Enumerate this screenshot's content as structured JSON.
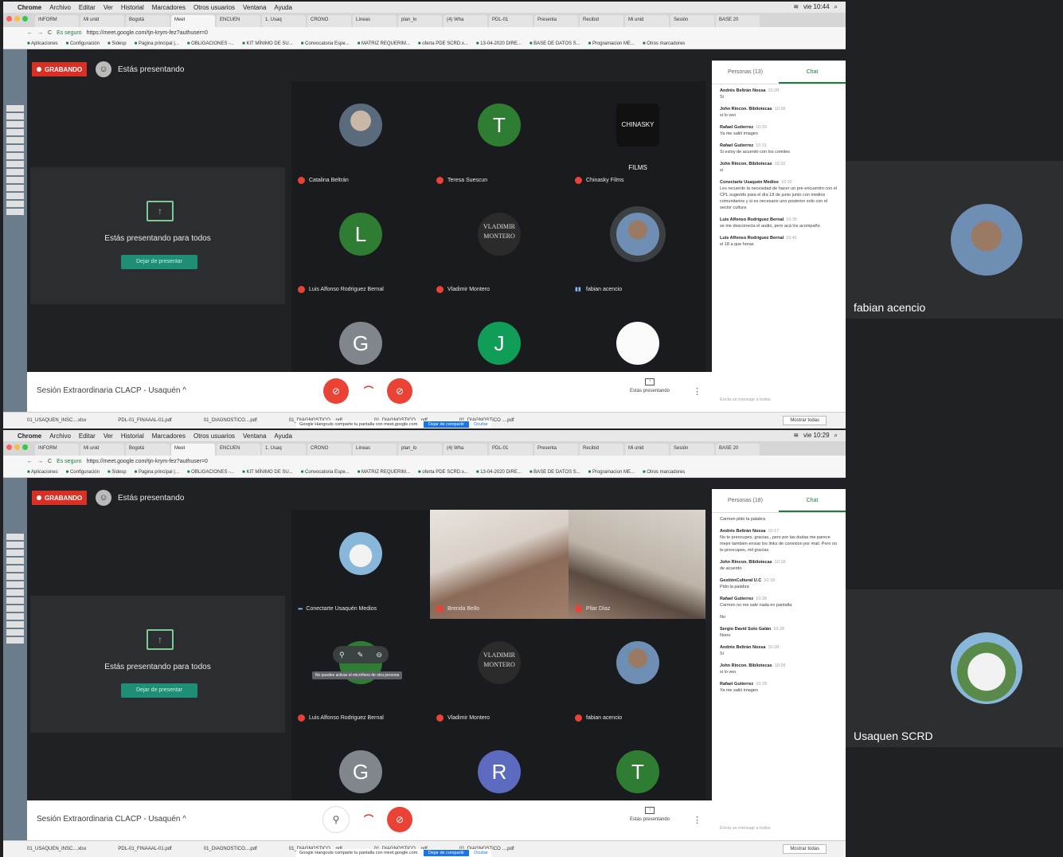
{
  "menubar": {
    "app": "Chrome",
    "items": [
      "Archivo",
      "Editar",
      "Ver",
      "Historial",
      "Marcadores",
      "Otros usuarios",
      "Ventana",
      "Ayuda"
    ]
  },
  "tabs": [
    "INFORM",
    "Mi unid",
    "Bogotá",
    "Meet",
    "ENCUEN",
    "1. Usaq",
    "CRONO",
    "Líneas",
    "plan_lo",
    "(4) Wha",
    "PDL-01",
    "Presenta",
    "Recibid",
    "Mi unid",
    "Sesión",
    "BASE 20"
  ],
  "address": {
    "secure_label": "Es seguro",
    "url": "https://meet.google.com/tjn-krym-fez?authuser=0"
  },
  "bookmarks": [
    "Aplicaciones",
    "Configuración",
    "Sidesp",
    "Pagina principal |...",
    "OBLIGACIONES -...",
    "KIT MÍNIMO DE SU...",
    "Convocatoria Espe...",
    "MATRIZ REQUERIM...",
    "oferta PDE SCRD.x...",
    "13-04-2020 DIRE...",
    "BASE DE DATOS S...",
    "Programacion ME...",
    "Otros marcadores"
  ],
  "meet": {
    "recording_label": "GRABANDO",
    "presenting_label": "Estás presentando",
    "present_panel_text": "Estás presentando para todos",
    "stop_presenting": "Dejar de presentar",
    "meeting_title": "Sesión Extraordinaria CLACP - Usaquén",
    "present_now_label": "Estás presentando",
    "chat_tab": "Chat",
    "chat_placeholder": "Envía un mensaje a todos",
    "downloads": [
      "01_USAQUEN_INSC....xlsx",
      "PDL-01_FINAAAL-01.pdf",
      "01_DIAGNOSTICO....pdf",
      "01_DIAGNOSTICO....pdf",
      "01_DIAGNOSTICO....pdf",
      "01_DIAGNOSTICO ....pdf"
    ],
    "show_all": "Mostrar todas",
    "share_notice": "Google Hangouts comparte tu pantalla con meet.google.com.",
    "share_stop": "Dejar de compartir",
    "share_hide": "Ocultar"
  },
  "top": {
    "clock": "vie 10:44",
    "people_tab": "Personas (13)",
    "tiles": [
      {
        "name": "Catalina Beltrán",
        "letter": "",
        "style": "photo",
        "mic": "off"
      },
      {
        "name": "Teresa Suescun",
        "letter": "T",
        "style": "green",
        "mic": "off"
      },
      {
        "name": "Chinasky Films",
        "letter": "CHINASKY FILMS",
        "style": "logo",
        "mic": "off"
      },
      {
        "name": "Luis Alfonso Rodriguez Bernal",
        "letter": "L",
        "style": "green",
        "mic": "off"
      },
      {
        "name": "Vladimir Montero",
        "letter": "VLADIMIR MONTERO",
        "style": "vlad",
        "mic": "off"
      },
      {
        "name": "fabian acencio",
        "letter": "",
        "style": "photo2",
        "mic": "on"
      },
      {
        "name": "",
        "letter": "G",
        "style": "grey",
        "mic": ""
      },
      {
        "name": "",
        "letter": "J",
        "style": "teal",
        "mic": ""
      },
      {
        "name": "",
        "letter": "",
        "style": "market",
        "mic": ""
      }
    ],
    "chat": [
      {
        "sender": "Andrés Beltrán Nossa",
        "time": "10:28",
        "text": "Si"
      },
      {
        "sender": "John Rincon. Bibliotecas",
        "time": "10:28",
        "text": "si lo veo"
      },
      {
        "sender": "Rafael Gutierrez",
        "time": "10:29",
        "text": "Ya me salió imagen"
      },
      {
        "sender": "Rafael Gutierrez",
        "time": "10:31",
        "text": "Si estoy de acuerdo con los comites"
      },
      {
        "sender": "John Rincon. Bibliotecas",
        "time": "10:32",
        "text": "si"
      },
      {
        "sender": "Conectarte Usaquén Medios",
        "time": "10:32",
        "text": "Les recuerdo la necesidad de hacer un pre-encuentro con el CPL sugerido para el día 18 de junio junto con medios comunitarios y si es necesario uno posterior solo con el sector cultura"
      },
      {
        "sender": "Luis Alfonso Rodriguez Bernal",
        "time": "10:35",
        "text": "se me desconecta el audio, pero acá los acompaño"
      },
      {
        "sender": "Luis Alfonso Rodriguez Bernal",
        "time": "10:41",
        "text": "el 18 a que horas"
      }
    ],
    "side_name": "fabian acencio"
  },
  "bottom": {
    "clock": "vie 10:29",
    "people_tab": "Personas (18)",
    "tiles": [
      {
        "name": "Conectarte Usaquén Medios",
        "letter": "",
        "style": "church",
        "mic": "dots"
      },
      {
        "name": "Brenda Bello",
        "letter": "",
        "style": "video1",
        "mic": "off"
      },
      {
        "name": "Pilar Díaz",
        "letter": "",
        "style": "video2",
        "mic": "off"
      },
      {
        "name": "Luis Alfonso Rodriguez Bernal",
        "letter": "",
        "style": "green",
        "mic": "off"
      },
      {
        "name": "Vladimir Montero",
        "letter": "VLADIMIR MONTERO",
        "style": "vlad",
        "mic": "off"
      },
      {
        "name": "fabian acencio",
        "letter": "",
        "style": "photo2",
        "mic": "off"
      },
      {
        "name": "",
        "letter": "G",
        "style": "grey",
        "mic": ""
      },
      {
        "name": "",
        "letter": "R",
        "style": "blue",
        "mic": ""
      },
      {
        "name": "",
        "letter": "T",
        "style": "green",
        "mic": ""
      }
    ],
    "tooltip": "No puedes activar el micrófono de otra persona",
    "chat": [
      {
        "sender": "",
        "time": "",
        "text": "Carmen pido la palabra"
      },
      {
        "sender": "Andrés Beltrán Nossa",
        "time": "10:17",
        "text": "No te preocupes, gracias., pero por las dudas me parece mejor tambien enviar los links de conexion por mail. Pero no te preocupes, mil gracias."
      },
      {
        "sender": "John Rincon. Bibliotecas",
        "time": "10:18",
        "text": "de acuerdo"
      },
      {
        "sender": "GestiónCultural U.C",
        "time": "10:18",
        "text": "Pido la palabra"
      },
      {
        "sender": "Rafael Gutierrez",
        "time": "10:28",
        "text": "Carmen no me sale nada en pantalla"
      },
      {
        "sender": "",
        "time": "",
        "text": "No"
      },
      {
        "sender": "Sergio David Soto Galán",
        "time": "10:28",
        "text": "Nooo"
      },
      {
        "sender": "Andrés Beltrán Nossa",
        "time": "10:28",
        "text": "Si"
      },
      {
        "sender": "John Rincon. Bibliotecas",
        "time": "10:28",
        "text": "si lo veo"
      },
      {
        "sender": "Rafael Gutierrez",
        "time": "10:29",
        "text": "Ya me salió imagen"
      }
    ],
    "side_name": "Usaquen SCRD"
  },
  "colors": {
    "green": "#2f7d32",
    "teal": "#0f9d58",
    "grey": "#80868b",
    "blue": "#5c6bc0",
    "red": "#ea4335"
  }
}
